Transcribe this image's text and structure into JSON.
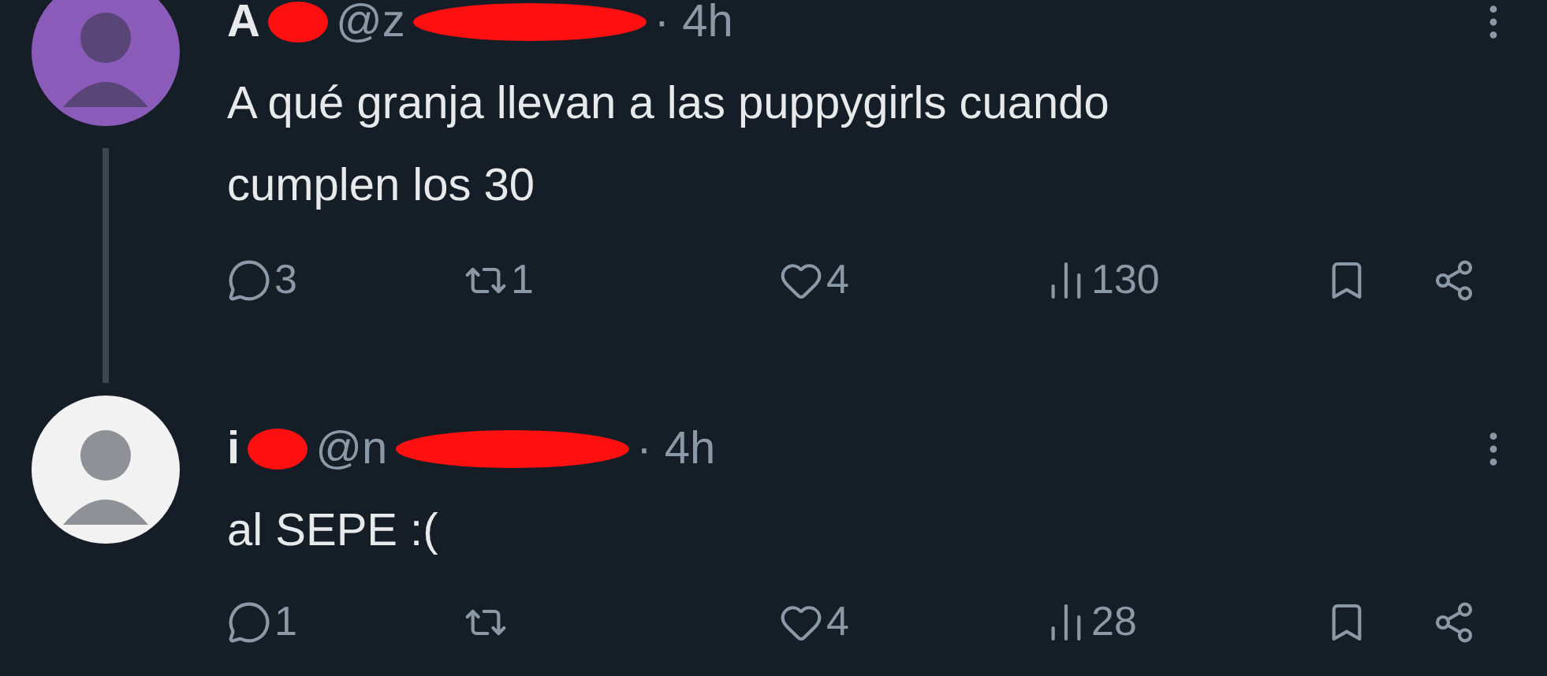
{
  "tweets": [
    {
      "name": "A",
      "handle": "@z",
      "time": "· 4h",
      "text": "A qué granja llevan a las puppygirls cuando cumplen los 30",
      "color": "#8a5bb8",
      "thread_line": true,
      "stats": {
        "replies": "3",
        "reposts": "1",
        "likes": "4",
        "views": "130"
      }
    },
    {
      "name": "i",
      "handle": "@n",
      "time": "· 4h",
      "text": "al SEPE :(",
      "color": "#f2f2f2",
      "thread_line": false,
      "stats": {
        "replies": "1",
        "likes": "4",
        "views": "28"
      }
    }
  ]
}
